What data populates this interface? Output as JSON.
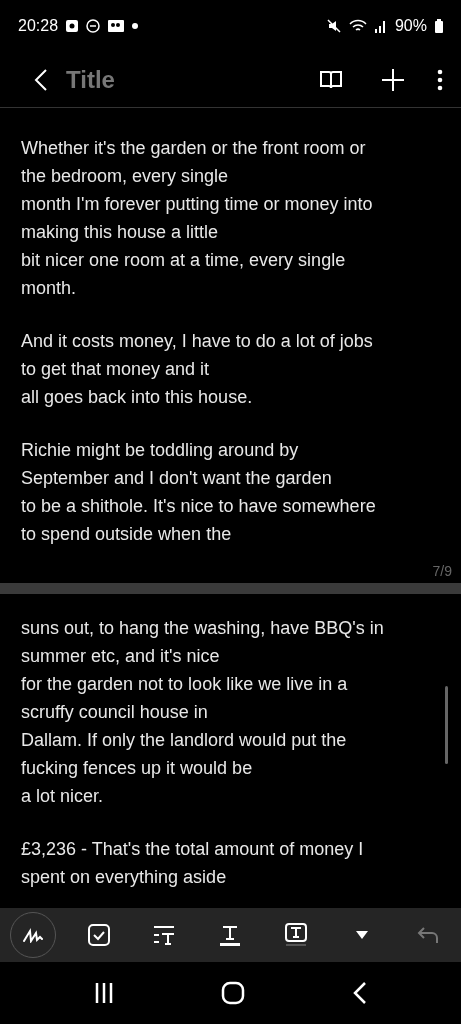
{
  "status_bar": {
    "time": "20:28",
    "battery": "90%"
  },
  "header": {
    "title": "Title"
  },
  "pages": [
    {
      "paragraphs": [
        "Whether it's the garden or the front room or\nthe bedroom, every single\nmonth I'm forever putting time or money into\nmaking this house a little\nbit nicer one room at a time, every single\nmonth.",
        "And it costs money, I have to do a lot of jobs\nto get that money and it\nall goes back into this house.",
        "Richie might be toddling around by\nSeptember and I don't want the garden\nto be a shithole. It's nice to have somewhere\nto spend outside when the"
      ],
      "page_number": "7/9"
    },
    {
      "paragraphs": [
        "suns out, to hang the washing, have BBQ's in\nsummer etc, and it's nice\nfor the garden not to look like we live in a\nscruffy council house in\nDallam. If only the landlord would put the\nfucking fences up it would be\na lot nicer.",
        "£3,236 - That's the total amount of money I\nspent on everything aside"
      ]
    }
  ],
  "toolbar": {
    "undo_disabled": true
  }
}
